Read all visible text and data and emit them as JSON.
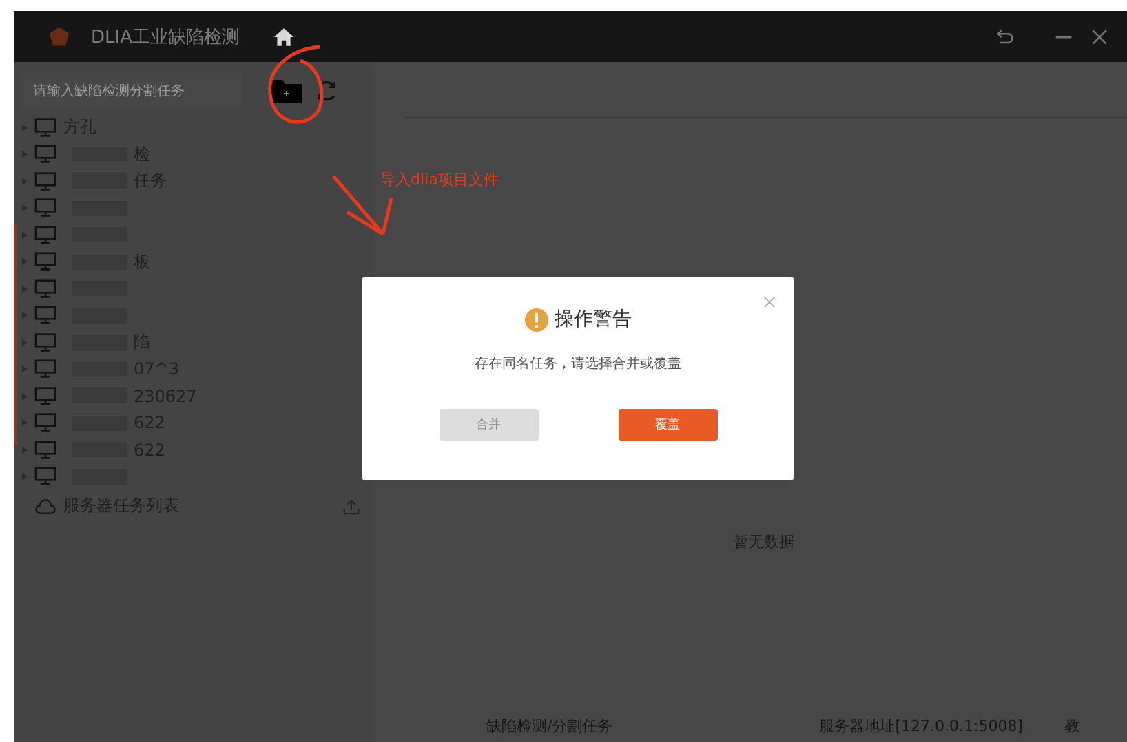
{
  "app": {
    "title": "DLIA工业缺陷检测"
  },
  "sidebar": {
    "search": {
      "placeholder": "请输入缺陷检测分割任务"
    },
    "tasks": [
      {
        "label": "方孔",
        "redacted": false
      },
      {
        "label": "检",
        "redacted": true
      },
      {
        "label": "任务",
        "redacted": true
      },
      {
        "redacted": true
      },
      {
        "redacted": true
      },
      {
        "label": "板",
        "redacted": true
      },
      {
        "redacted": true
      },
      {
        "redacted": true
      },
      {
        "label": "陷",
        "redacted": true
      },
      {
        "label": "07^3",
        "redacted": true
      },
      {
        "label": "230627",
        "redacted": true
      },
      {
        "label": "622",
        "redacted": true
      },
      {
        "label": "622",
        "redacted": true
      },
      {
        "redacted": true
      }
    ],
    "server_section": {
      "label": "服务器任务列表"
    }
  },
  "main": {
    "empty_text": "暂无数据"
  },
  "status_bar": [
    "缺陷检测/分割任务",
    "服务器地址[127.0.0.1:5008]",
    "教"
  ],
  "dialog": {
    "title": "操作警告",
    "message": "存在同名任务，请选择合并或覆盖",
    "buttons": [
      {
        "label": "合并",
        "disabled": true
      },
      {
        "label": "覆盖",
        "disabled": false
      }
    ]
  },
  "annotation": {
    "text": "导入dlia项目文件"
  }
}
